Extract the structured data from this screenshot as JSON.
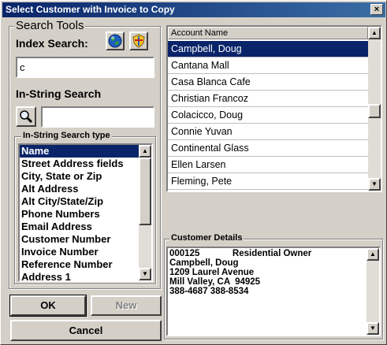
{
  "window": {
    "title": "Select Customer with Invoice to Copy",
    "close_glyph": "×"
  },
  "search_tools": {
    "title": "Search Tools",
    "index_label": "Index Search:",
    "index_value": "c",
    "instring_label": "In-String Search",
    "instring_value": ""
  },
  "instring_type": {
    "label": "In-String Search type",
    "items": [
      "Name",
      "Street Address fields",
      "City, State or Zip",
      "Alt Address",
      "Alt City/State/Zip",
      "Phone Numbers",
      "Email Address",
      "Customer Number",
      "Invoice Number",
      "Reference Number",
      "Address 1"
    ],
    "selected_index": 0
  },
  "accounts": {
    "header": "Account Name",
    "items": [
      "Campbell, Doug",
      "Cantana Mall",
      "Casa Blanca Cafe",
      "Christian Francoz",
      "Colacicco, Doug",
      "Connie Yuvan",
      "Continental Glass",
      "Ellen Larsen",
      "Fleming, Pete"
    ],
    "selected_index": 0
  },
  "details": {
    "label": "Customer Details",
    "lines": [
      "000125             Residential Owner",
      "Campbell, Doug",
      "1209 Laurel Avenue",
      "Mill Valley, CA  94925",
      "388-4687 388-8534"
    ]
  },
  "buttons": {
    "ok": "OK",
    "new": "New",
    "cancel": "Cancel"
  },
  "icons": {
    "globe": "globe-icon",
    "shield": "shield-icon",
    "magnifier": "magnifier-icon"
  }
}
